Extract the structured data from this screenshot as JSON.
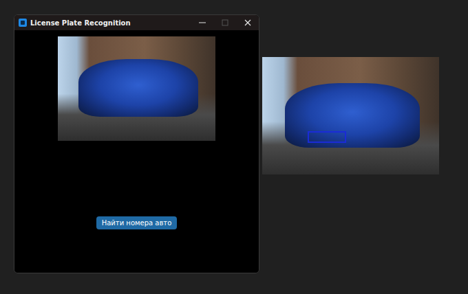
{
  "window": {
    "title": "License Plate Recognition",
    "controls": [
      {
        "name": "minimize",
        "disabled": false
      },
      {
        "name": "maximize",
        "disabled": true
      },
      {
        "name": "close",
        "disabled": false
      }
    ]
  },
  "button": {
    "label": "Найти номера авто"
  },
  "result_image": {
    "plate_detected": true
  }
}
